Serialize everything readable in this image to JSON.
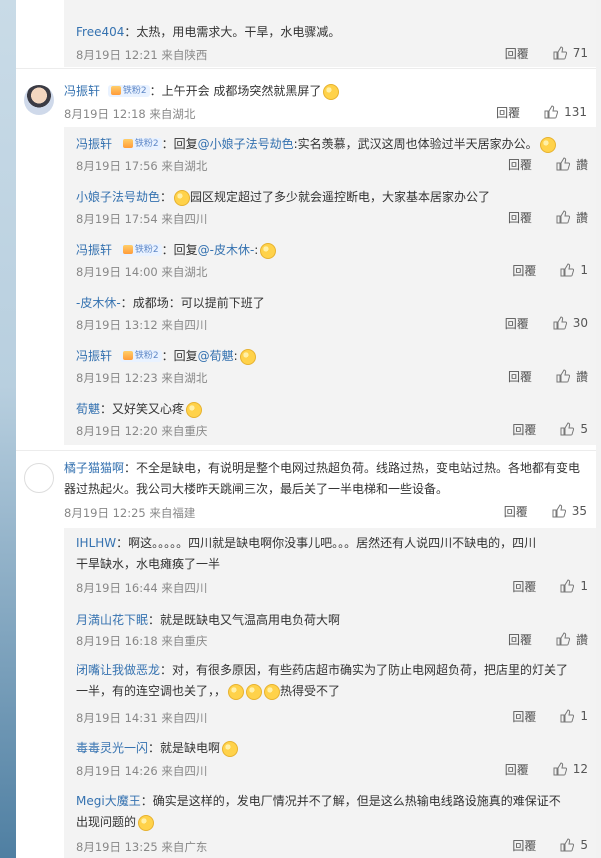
{
  "comments": [
    {
      "user": "Free404",
      "text": "太热，用电需求大。干旱，水电骤减。",
      "date": "8月19日 12:21 来自陕西",
      "reply": "回覆",
      "likes": "71"
    },
    {
      "user": "冯振轩",
      "badge": "铁粉2",
      "text": "上午开会 成都场突然就黑屏了",
      "date": "8月19日 12:18 来自湖北",
      "reply": "回覆",
      "likes": "131",
      "replies": [
        {
          "user": "冯振轩",
          "badge": "铁粉2",
          "prefix": "回复",
          "mention": "@小娘子法号劫色",
          "text": ":实名羡慕，武汉这周也体验过半天居家办公。",
          "date": "8月19日 17:56 来自湖北",
          "reply": "回覆",
          "likes": "讚"
        },
        {
          "user": "小娘子法号劫色",
          "text": "园区规定超过了多少就会遥控断电，大家基本居家办公了",
          "date": "8月19日 17:54 来自四川",
          "reply": "回覆",
          "likes": "讚"
        },
        {
          "user": "冯振轩",
          "badge": "铁粉2",
          "prefix": "回复",
          "mention": "@-皮木休-",
          "text": ":",
          "date": "8月19日 14:00 来自湖北",
          "reply": "回覆",
          "likes": "1"
        },
        {
          "user": "-皮木休-",
          "text": "成都场：可以提前下班了",
          "date": "8月19日 13:12 来自四川",
          "reply": "回覆",
          "likes": "30"
        },
        {
          "user": "冯振轩",
          "badge": "铁粉2",
          "prefix": "回复",
          "mention": "@荀魌",
          "text": ":",
          "date": "8月19日 12:23 来自湖北",
          "reply": "回覆",
          "likes": "讚"
        },
        {
          "user": "荀魌",
          "text": "又好笑又心疼",
          "date": "8月19日 12:20 来自重庆",
          "reply": "回覆",
          "likes": "5"
        }
      ]
    },
    {
      "user": "橘子猫猫啊",
      "text_line1": "不全是缺电，有说明是整个电网过热超负荷。线路过热，变电站过热。各地都有变电",
      "text_line2": "器过热起火。我公司大楼昨天跳闸三次，最后关了一半电梯和一些设备。",
      "date": "8月19日 12:25 来自福建",
      "reply": "回覆",
      "likes": "35",
      "replies": [
        {
          "user": "IHLHW",
          "text_line1": "啊这。。。。。四川就是缺电啊你没事儿吧。。。居然还有人说四川不缺电的，四川",
          "text_line2": "干旱缺水，水电瘫痪了一半",
          "date": "8月19日 16:44 来自四川",
          "reply": "回覆",
          "likes": "1"
        },
        {
          "user": "月満山花下眠",
          "text": "就是既缺电又气温高用电负荷大啊",
          "date": "8月19日 16:18 来自重庆",
          "reply": "回覆",
          "likes": "讚"
        },
        {
          "user": "闭嘴让我做恶龙",
          "text_line1": "对，有很多原因，有些药店超市确实为了防止电网超负荷，把店里的灯关了",
          "text_line2": "一半，有的连空调也关了，，",
          "text_line2_tail": "热得受不了",
          "date": "8月19日 14:31 来自四川",
          "reply": "回覆",
          "likes": "1"
        },
        {
          "user": "毒毒灵光一闪",
          "text": "就是缺电啊",
          "date": "8月19日 14:26 来自四川",
          "reply": "回覆",
          "likes": "12"
        },
        {
          "user": "Megi大魔王",
          "text_line1": "确实是这样的，发电厂情况并不了解，但是这么热输电线路设施真的难保证不",
          "text_line2": "出现问题的",
          "date": "8月19日 13:25 来自广东",
          "reply": "回覆",
          "likes": "5"
        }
      ]
    }
  ]
}
